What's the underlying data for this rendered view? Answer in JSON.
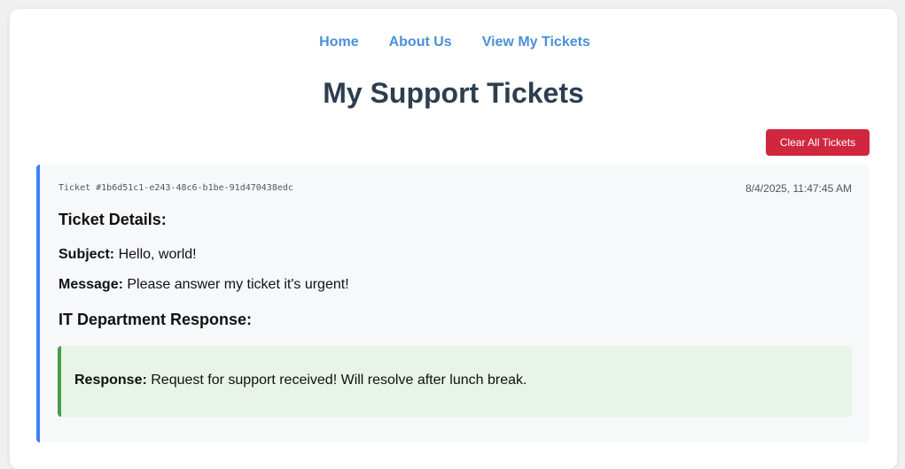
{
  "nav": {
    "home": "Home",
    "about": "About Us",
    "tickets": "View My Tickets"
  },
  "page_title": "My Support Tickets",
  "clear_button": "Clear All Tickets",
  "ticket": {
    "id": "Ticket #1b6d51c1-e243-48c6-b1be-91d470438edc",
    "timestamp": "8/4/2025, 11:47:45 AM",
    "details_heading": "Ticket Details:",
    "subject_label": "Subject:",
    "subject": "Hello, world!",
    "message_label": "Message:",
    "message": "Please answer my ticket it's urgent!",
    "response_heading": "IT Department Response:",
    "response_label": "Response:",
    "response": "Request for support received! Will resolve after lunch break."
  },
  "colors": {
    "nav_link": "#4a90d9",
    "title": "#2c3e50",
    "danger_button": "#d0273f",
    "ticket_accent": "#3b82f6",
    "response_accent": "#43a047",
    "response_bg": "#e7f4e7"
  }
}
